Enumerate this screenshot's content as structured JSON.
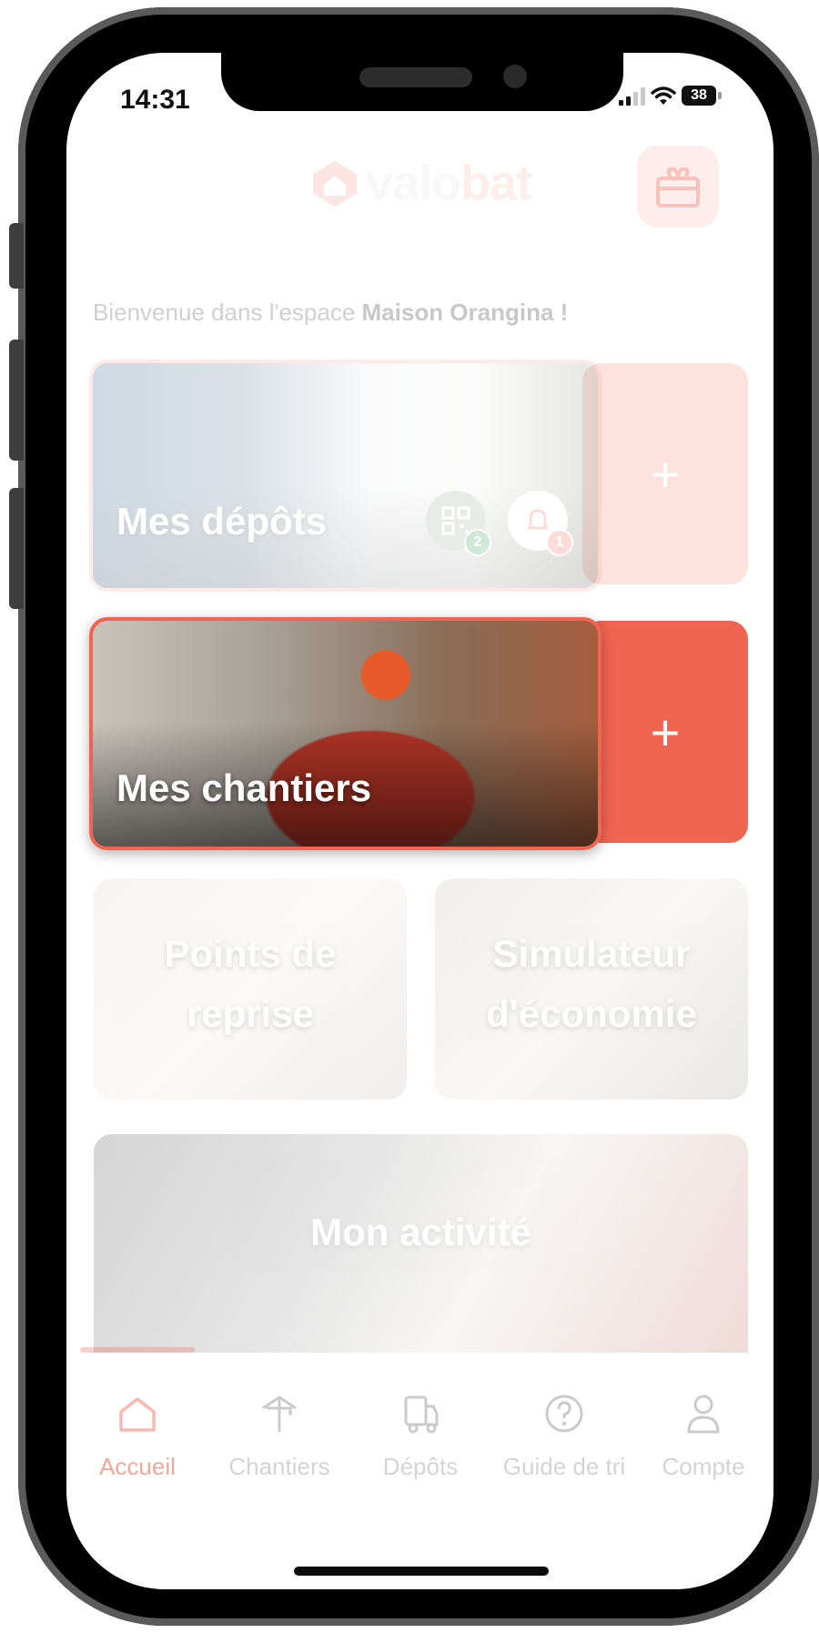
{
  "status_bar": {
    "time": "14:31",
    "battery": "38"
  },
  "header": {
    "logo_part1": "valo",
    "logo_part2": "bat"
  },
  "welcome": {
    "prefix": "Bienvenue dans l'espace ",
    "company": "Maison Orangina !"
  },
  "cards": {
    "depots": {
      "title": "Mes dépôts",
      "qr_count": "2",
      "alert_count": "1",
      "plus": "+"
    },
    "chantiers": {
      "title": "Mes chantiers",
      "plus": "+"
    },
    "points": {
      "title_line1": "Points de",
      "title_line2": "reprise"
    },
    "simulateur": {
      "title_line1": "Simulateur",
      "title_line2": "d'économie"
    },
    "activite": {
      "title": "Mon activité"
    }
  },
  "tabs": [
    {
      "label": "Accueil",
      "icon": "home-icon"
    },
    {
      "label": "Chantiers",
      "icon": "crane-icon"
    },
    {
      "label": "Dépôts",
      "icon": "truck-icon"
    },
    {
      "label": "Guide de tri",
      "icon": "question-icon"
    },
    {
      "label": "Compte",
      "icon": "user-icon"
    }
  ],
  "colors": {
    "accent": "#f06552",
    "accent_light": "#fde7e4"
  }
}
